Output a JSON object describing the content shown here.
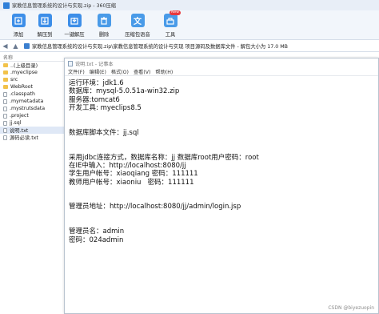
{
  "window": {
    "title": "家教信息管理系统的设计与实现.zip - 360压缩"
  },
  "toolbar": {
    "items": [
      {
        "label": "添加",
        "icon": "add-icon",
        "color": "#3d8ee8"
      },
      {
        "label": "解压到",
        "icon": "extract-icon",
        "color": "#3d8ee8"
      },
      {
        "label": "一键解压",
        "icon": "one-click-extract-icon",
        "color": "#3d8ee8"
      },
      {
        "label": "删除",
        "icon": "delete-icon",
        "color": "#4a9be8"
      },
      {
        "label": "压缩包语音",
        "icon": "voice-icon",
        "color": "#4a9be8"
      },
      {
        "label": "工具",
        "icon": "tools-icon",
        "color": "#4a9be8"
      }
    ],
    "tools_badge": "New"
  },
  "addressbar": {
    "path": "家教信息管理系统的设计与实现.zip\\家教信息管理系统的设计与实现 项目源码及数据库文件 - 解包大小为 17.0 MB"
  },
  "filelist": {
    "column_name": "名称",
    "rows": [
      {
        "name": "..(上级目录)",
        "type": "folder"
      },
      {
        "name": ".myeclipse",
        "type": "folder"
      },
      {
        "name": "src",
        "type": "folder"
      },
      {
        "name": "WebRoot",
        "type": "folder"
      },
      {
        "name": ".classpath",
        "type": "file"
      },
      {
        "name": ".mymetadata",
        "type": "file"
      },
      {
        "name": ".mystrutsdata",
        "type": "file"
      },
      {
        "name": ".project",
        "type": "file"
      },
      {
        "name": "jj.sql",
        "type": "file"
      },
      {
        "name": "说明.txt",
        "type": "file",
        "selected": true
      },
      {
        "name": "源码必读.txt",
        "type": "file"
      }
    ]
  },
  "notepad": {
    "title": "说明.txt - 记事本",
    "menu": [
      "文件(F)",
      "编辑(E)",
      "格式(O)",
      "查看(V)",
      "帮助(H)"
    ],
    "content": "运行环境：jdk1.6\n数据库：mysql-5.0.51a-win32.zip\n服务器:tomcat6\n开发工具: myeclips8.5\n\n\n数据库脚本文件：jj.sql\n\n\n采用jdbc连接方式，数据库名称：jj 数据库root用户密码：root\n在IE中输入：http://localhost:8080/jj\n学生用户帐号：xiaoqiang 密码：111111\n教师用户帐号：xiaoniu   密码：111111\n\n\n管理员地址：http://localhost:8080/jj/admin/login.jsp\n\n\n管理员名：admin\n密码：024admin"
  },
  "watermark": "CSDN @biyezuopin"
}
